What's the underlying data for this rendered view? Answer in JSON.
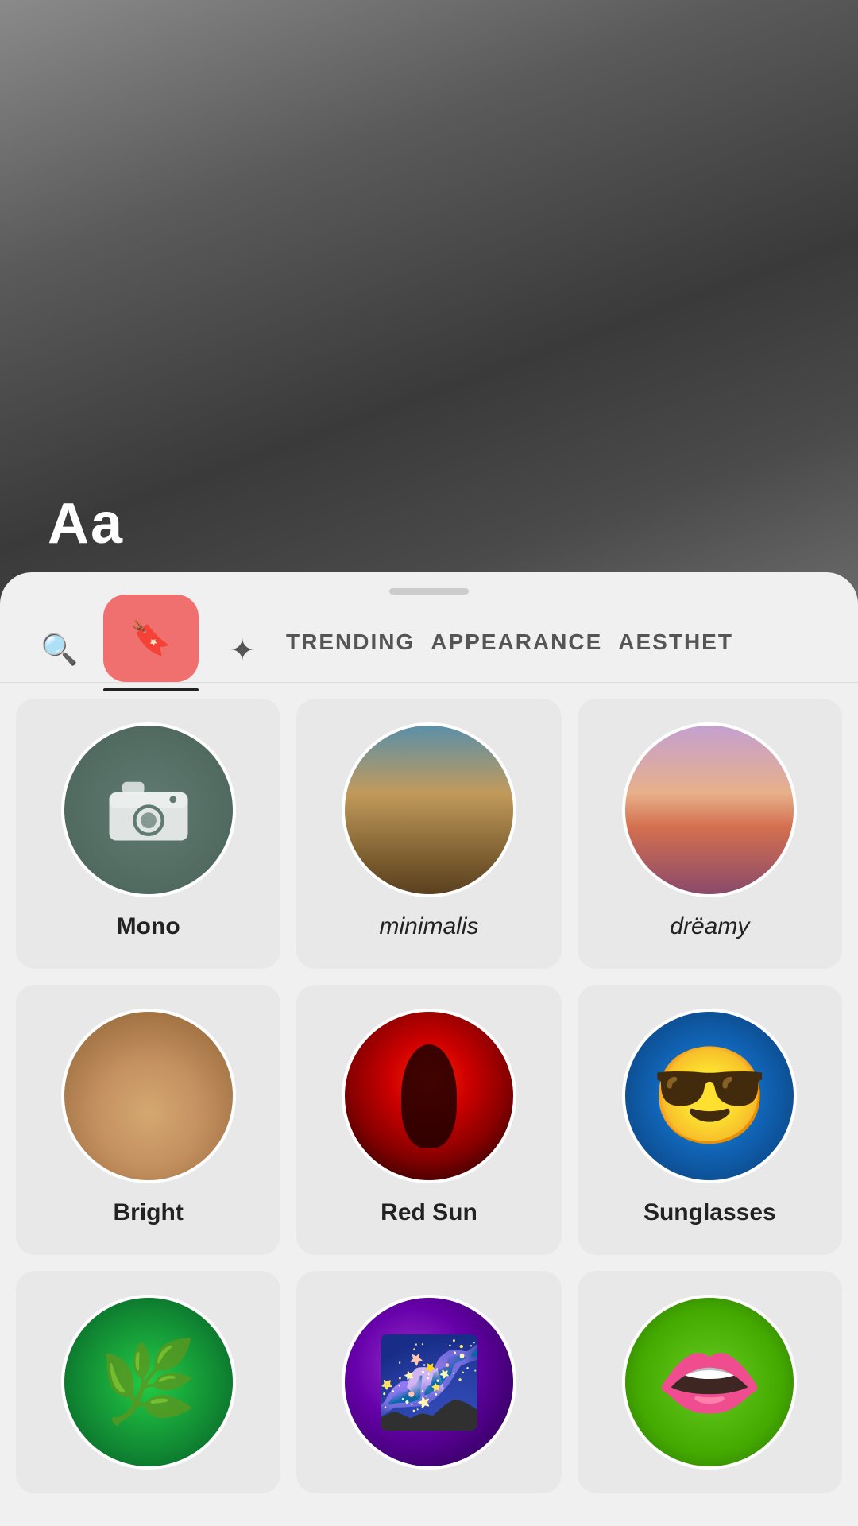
{
  "camera": {
    "aa_label": "Aa"
  },
  "bottom_sheet": {
    "drag_handle": "",
    "tabs": [
      {
        "id": "search",
        "icon": "🔍",
        "label": null,
        "type": "icon"
      },
      {
        "id": "saved",
        "icon": "🔖",
        "label": null,
        "type": "saved"
      },
      {
        "id": "sparkle",
        "icon": "✦",
        "label": null,
        "type": "icon"
      },
      {
        "id": "trending",
        "label": "TRENDING",
        "active": false
      },
      {
        "id": "appearance",
        "label": "APPEARANCE",
        "active": false
      },
      {
        "id": "aesthetic",
        "label": "AESTHET",
        "active": false
      }
    ],
    "effects": [
      {
        "id": "mono",
        "name": "Mono",
        "style": "normal",
        "thumb": "mono"
      },
      {
        "id": "minimalis",
        "name": "minimalis",
        "style": "italic",
        "thumb": "minimalis"
      },
      {
        "id": "dreamy",
        "name": "drëamy",
        "style": "italic",
        "thumb": "dreamy"
      },
      {
        "id": "bright",
        "name": "Bright",
        "style": "normal",
        "thumb": "bright"
      },
      {
        "id": "redsun",
        "name": "Red Sun",
        "style": "normal",
        "thumb": "redsun"
      },
      {
        "id": "sunglasses",
        "name": "Sunglasses",
        "style": "normal",
        "thumb": "sunglasses"
      },
      {
        "id": "leaf",
        "name": "",
        "style": "normal",
        "thumb": "leaf"
      },
      {
        "id": "galaxy",
        "name": "",
        "style": "normal",
        "thumb": "galaxy"
      },
      {
        "id": "mouth",
        "name": "",
        "style": "normal",
        "thumb": "mouth"
      }
    ]
  }
}
